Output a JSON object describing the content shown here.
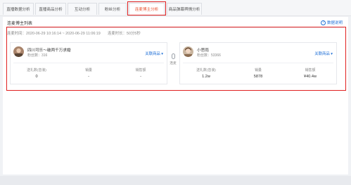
{
  "tabs": [
    {
      "label": "直播数据分析",
      "active": false
    },
    {
      "label": "直播商品分析",
      "active": false
    },
    {
      "label": "互动分析",
      "active": false
    },
    {
      "label": "粉丝分析",
      "active": false
    },
    {
      "label": "连麦博主分析",
      "active": true
    },
    {
      "label": "商品弹幕舆情分析",
      "active": false
    }
  ],
  "panel": {
    "title": "连麦博主列表",
    "help_label": "数据说明",
    "time_range": "连麦时间：2020-06-29 10:16:14 ~ 2020-06-29 11:06:19",
    "duration": "连麦时长：50分5秒"
  },
  "vs_label": "连麦",
  "anchors": [
    {
      "name": "四川可乐～破两千万求婚",
      "fans": "粉丝数：316",
      "link_label": "关联商品",
      "stats": [
        {
          "label": "送礼数(音浪)",
          "value": "0"
        },
        {
          "label": "销量",
          "value": "-"
        },
        {
          "label": "销售额",
          "value": "-"
        }
      ]
    },
    {
      "name": "小思雨",
      "fans": "粉丝数：53366",
      "link_label": "关联商品",
      "stats": [
        {
          "label": "送礼数(音浪)",
          "value": "1.2w"
        },
        {
          "label": "销量",
          "value": "5878"
        },
        {
          "label": "销售额",
          "value": "¥40.4w"
        }
      ]
    }
  ],
  "colors": {
    "accent": "#e8502f",
    "link": "#1f6fd6",
    "highlight": "#e02020"
  }
}
